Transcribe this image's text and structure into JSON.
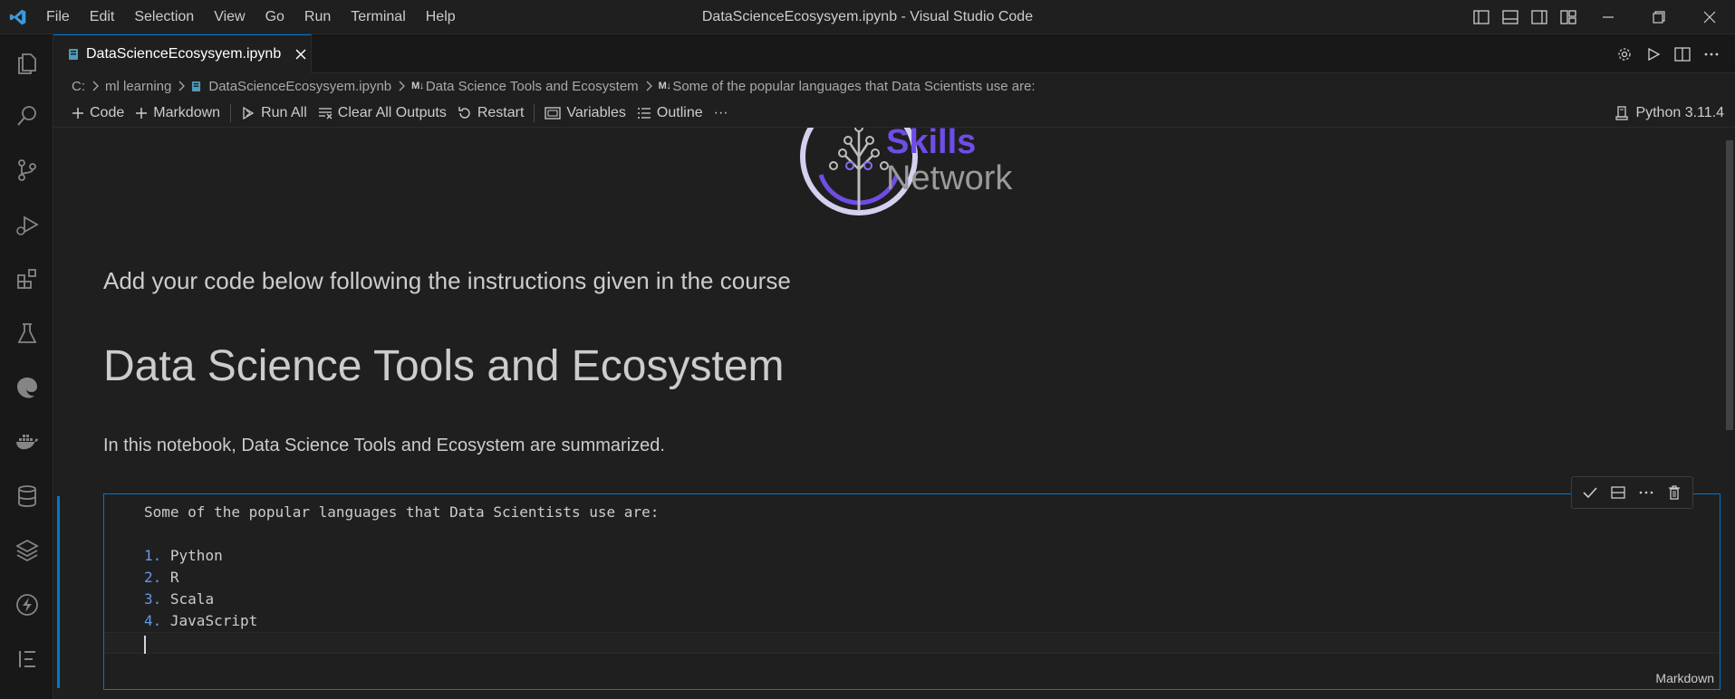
{
  "window": {
    "title": "DataScienceEcosysyem.ipynb - Visual Studio Code"
  },
  "menu": [
    "File",
    "Edit",
    "Selection",
    "View",
    "Go",
    "Run",
    "Terminal",
    "Help"
  ],
  "tab": {
    "label": "DataScienceEcosysyem.ipynb"
  },
  "breadcrumb": {
    "drive": "C:",
    "folder": "ml learning",
    "file": "DataScienceEcosysyem.ipynb",
    "md_badge": "M↓",
    "section": "Data Science Tools and Ecosystem",
    "cell": "Some of the popular languages that Data Scientists use are:"
  },
  "notebook_toolbar": {
    "code": "Code",
    "markdown": "Markdown",
    "run_all": "Run All",
    "clear_outputs": "Clear All Outputs",
    "restart": "Restart",
    "variables": "Variables",
    "outline": "Outline",
    "more": "···",
    "kernel": "Python 3.11.4"
  },
  "notebook": {
    "logo_word1": "Skills",
    "logo_word2": "Network",
    "instruction": "Add your code below following the instructions given in the course",
    "heading": "Data Science Tools and Ecosystem",
    "intro": "In this notebook, Data Science Tools and Ecosystem are summarized.",
    "cell": {
      "first_line": "Some of the popular languages that Data Scientists use are:",
      "items": [
        {
          "num": "1.",
          "text": "Python"
        },
        {
          "num": "2.",
          "text": "R"
        },
        {
          "num": "3.",
          "text": "Scala"
        },
        {
          "num": "4.",
          "text": "JavaScript"
        }
      ],
      "language": "Markdown"
    }
  },
  "colors": {
    "accent": "#0078d4",
    "skills_purple": "#6f4de6",
    "list_number": "#6796e6"
  }
}
